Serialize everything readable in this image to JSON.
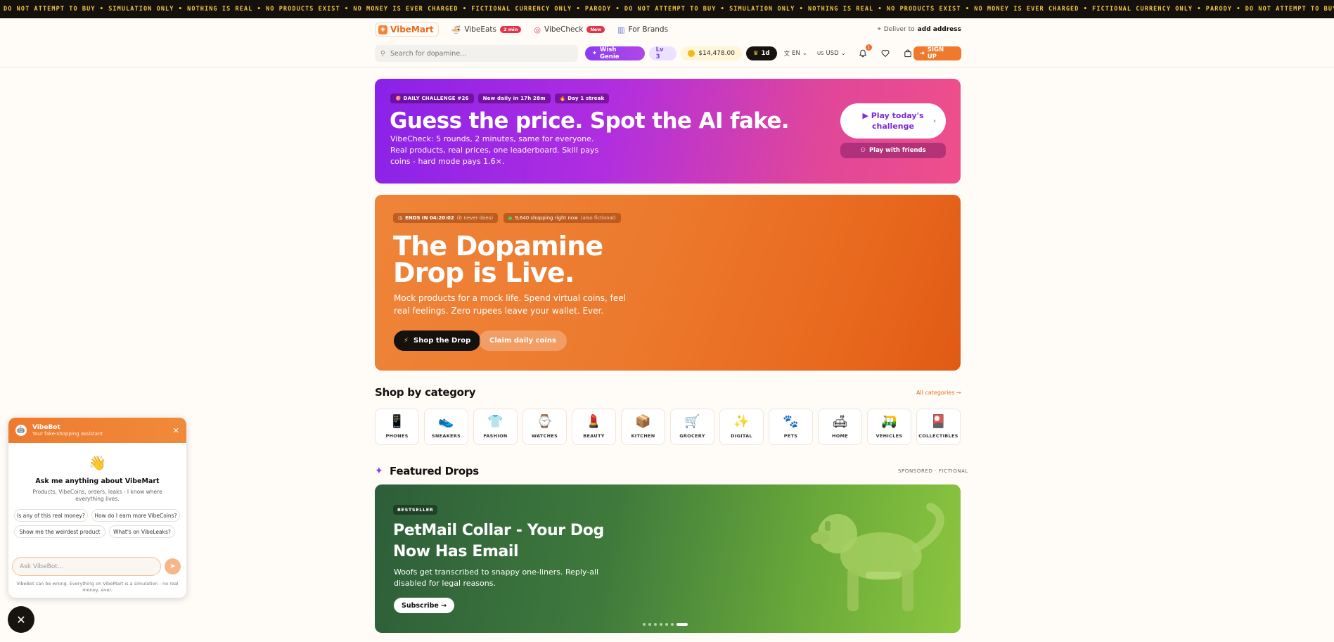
{
  "ticker": {
    "text": "DO NOT ATTEMPT TO BUY • SIMULATION ONLY • NOTHING IS REAL • NO PRODUCTS EXIST • NO MONEY IS EVER CHARGED • FICTIONAL CURRENCY ONLY • PARODY • DO NOT ATTEMPT TO BUY • SIMULATION ONLY • NOTHING IS REAL • NO PRODUCTS EXIST • NO MONEY IS EVER CHARGED • FICTIONAL CURRENCY ONLY • PARODY • DO NOT ATTEMPT TO BUY • SIMULATION ONLY • NOTHING IS REAL • NO PRODUCTS EXIST • NO MONEY IS EVER CHARGED • FICTIONAL CURRENCY ONLY • PARODY"
  },
  "header": {
    "logo": "VibeMart",
    "links": [
      {
        "label": "VibeEats",
        "badge": "2 min"
      },
      {
        "label": "VibeCheck",
        "badge": "New"
      },
      {
        "label": "For Brands"
      }
    ],
    "deliver_prefix": "Deliver to",
    "deliver_target": "add address"
  },
  "toolbar": {
    "search_placeholder": "Search for dopamine...",
    "wish_genie": "Wish Genie",
    "level": "Lv 3",
    "coins": "$14,478.00",
    "streak": "1d",
    "lang": "EN",
    "currency_flag": "US",
    "currency": "USD",
    "notification_count": "1",
    "signup": "SIGN UP"
  },
  "challenge": {
    "tags": [
      "DAILY CHALLENGE #26",
      "New daily in 17h 28m",
      "Day 1 streak"
    ],
    "title": "Guess the price. Spot the AI fake.",
    "subtitle": "VibeCheck: 5 rounds, 2 minutes, same for everyone. Real products, real prices, one leaderboard. Skill pays coins - hard mode pays 1.6×.",
    "play_label": "▶ Play today's challenge",
    "friends_label": "Play with friends"
  },
  "drop": {
    "ends_label": "ENDS IN 04:20:02",
    "ends_note": "(it never does)",
    "shoppers": "9,640 shopping right now",
    "shoppers_note": "(also fictional)",
    "title": "The Dopamine Drop is Live.",
    "subtitle": "Mock products for a mock life. Spend virtual coins, feel real feelings. Zero rupees leave your wallet. Ever.",
    "shop_label": "Shop the Drop",
    "claim_label": "Claim daily coins"
  },
  "categories": {
    "title": "Shop by category",
    "all_link": "All categories →",
    "items": [
      {
        "label": "PHONES",
        "icon": "📱"
      },
      {
        "label": "SNEAKERS",
        "icon": "👟"
      },
      {
        "label": "FASHION",
        "icon": "👕"
      },
      {
        "label": "WATCHES",
        "icon": "⌚"
      },
      {
        "label": "BEAUTY",
        "icon": "💄"
      },
      {
        "label": "KITCHEN",
        "icon": "📦"
      },
      {
        "label": "GROCERY",
        "icon": "🛒"
      },
      {
        "label": "DIGITAL",
        "icon": "✨"
      },
      {
        "label": "PETS",
        "icon": "🐾"
      },
      {
        "label": "HOME",
        "icon": "🛋"
      },
      {
        "label": "VEHICLES",
        "icon": "🛺"
      },
      {
        "label": "COLLECTIBLES",
        "icon": "🎴"
      }
    ]
  },
  "featured": {
    "title": "Featured Drops",
    "sponsored": "SPONSORED · FICTIONAL",
    "badge": "BESTSELLER",
    "product_title": "PetMail Collar - Your Dog Now Has Email",
    "product_desc": "Woofs get transcribed to snappy one-liners. Reply-all disabled for legal reasons.",
    "cta": "Subscribe →",
    "slides_total": 7,
    "slide_active": 7
  },
  "vibebot": {
    "name": "VibeBot",
    "tagline": "Your fake-shopping assistant",
    "heading": "Ask me anything about VibeMart",
    "description": "Products, VibeCoins, orders, leaks - I know where everything lives.",
    "suggestions": [
      "Is any of this real money?",
      "How do I earn more VibeCoins?",
      "Show me the weirdest product",
      "What's on VibeLeaks?"
    ],
    "input_placeholder": "Ask VibeBot...",
    "disclaimer": "VibeBot can be wrong. Everything on VibeMart is a simulation - no real money, ever."
  },
  "colors": {
    "accent": "#ef7a2e",
    "purple": "#8a22e8",
    "green": "#3f7a3c",
    "dark": "#15110d"
  }
}
